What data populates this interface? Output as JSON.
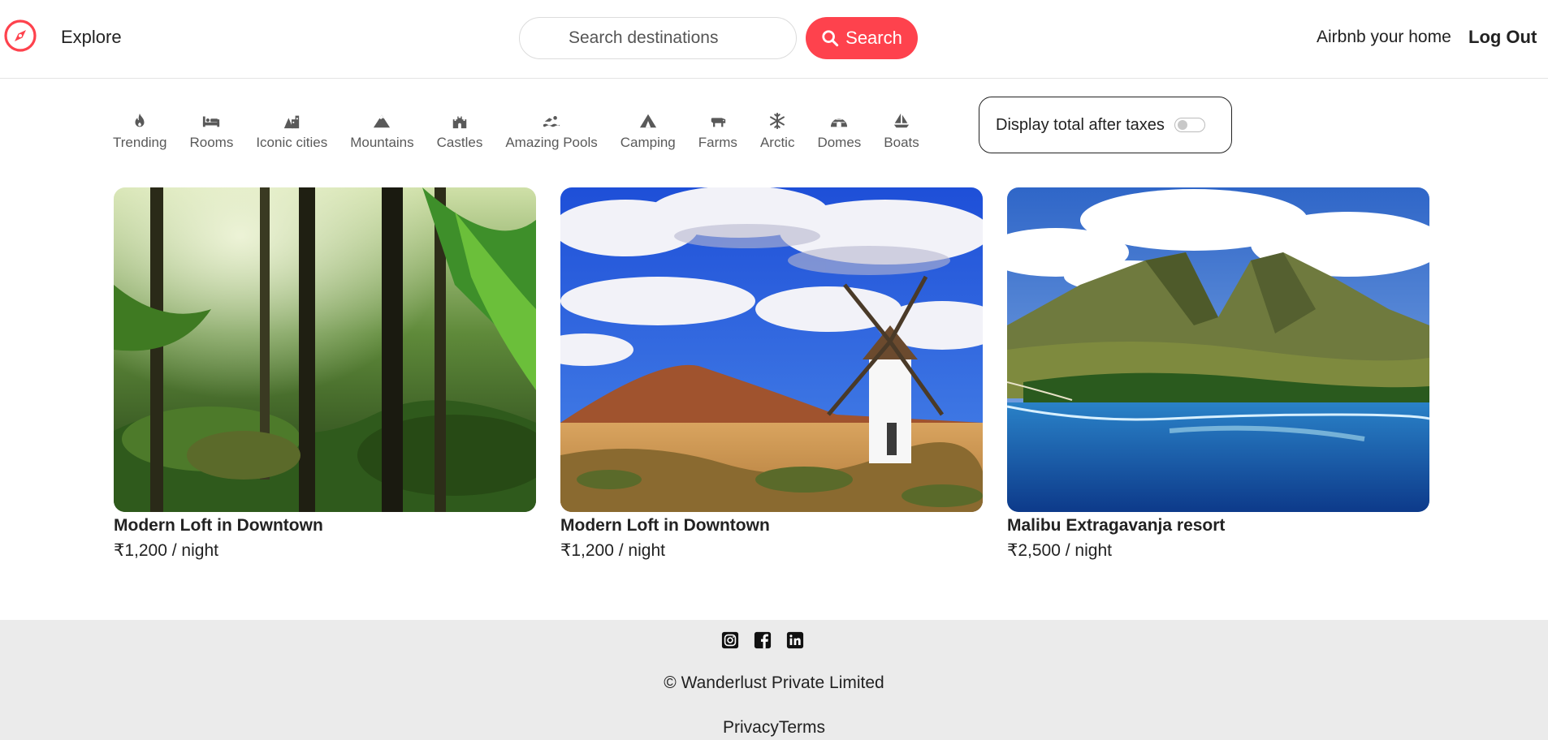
{
  "navbar": {
    "logo_icon": "compass-icon",
    "brand_color": "#fe424d",
    "explore_label": "Explore",
    "search_placeholder": "Search destinations",
    "search_button_label": "Search",
    "search_icon": "search-icon",
    "host_label": "Airbnb your home",
    "logout_label": "Log Out"
  },
  "filters": [
    {
      "label": "Trending",
      "icon": "fire-icon"
    },
    {
      "label": "Rooms",
      "icon": "bed-icon"
    },
    {
      "label": "Iconic cities",
      "icon": "city-icon"
    },
    {
      "label": "Mountains",
      "icon": "mountain-icon"
    },
    {
      "label": "Castles",
      "icon": "castle-icon"
    },
    {
      "label": "Amazing Pools",
      "icon": "swimmer-icon"
    },
    {
      "label": "Camping",
      "icon": "tent-icon"
    },
    {
      "label": "Farms",
      "icon": "cow-icon"
    },
    {
      "label": "Arctic",
      "icon": "snowflake-icon"
    },
    {
      "label": "Domes",
      "icon": "igloo-icon"
    },
    {
      "label": "Boats",
      "icon": "sailboat-icon"
    }
  ],
  "tax_toggle": {
    "label": "Display total after taxes",
    "enabled": false
  },
  "listings": [
    {
      "title": "Modern Loft in Downtown",
      "price": "₹1,200 / night",
      "image": "jungle-forest"
    },
    {
      "title": "Modern Loft in Downtown",
      "price": "₹1,200 / night",
      "image": "windmill-landscape"
    },
    {
      "title": "Malibu Extragavanja resort",
      "price": "₹2,500 / night",
      "image": "mountain-coast"
    }
  ],
  "footer": {
    "socials": [
      "instagram-icon",
      "facebook-icon",
      "linkedin-icon"
    ],
    "copyright": "© Wanderlust Private Limited",
    "links": "PrivacyTerms"
  }
}
